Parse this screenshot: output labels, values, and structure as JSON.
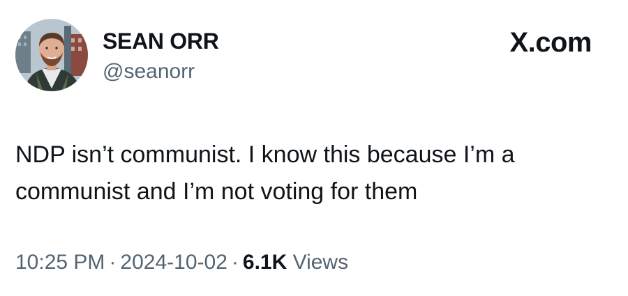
{
  "tweet": {
    "author": {
      "display_name": "SEAN ORR",
      "handle": "@seanorr"
    },
    "brand": "X.com",
    "text_lines": [
      "NDP isn’t communist. I know this because I’m a",
      "communist and I’m not voting for them"
    ],
    "meta": {
      "time": "10:25 PM",
      "separator": "·",
      "date": "2024-10-02",
      "views_count": "6.1K",
      "views_label": "Views"
    }
  }
}
